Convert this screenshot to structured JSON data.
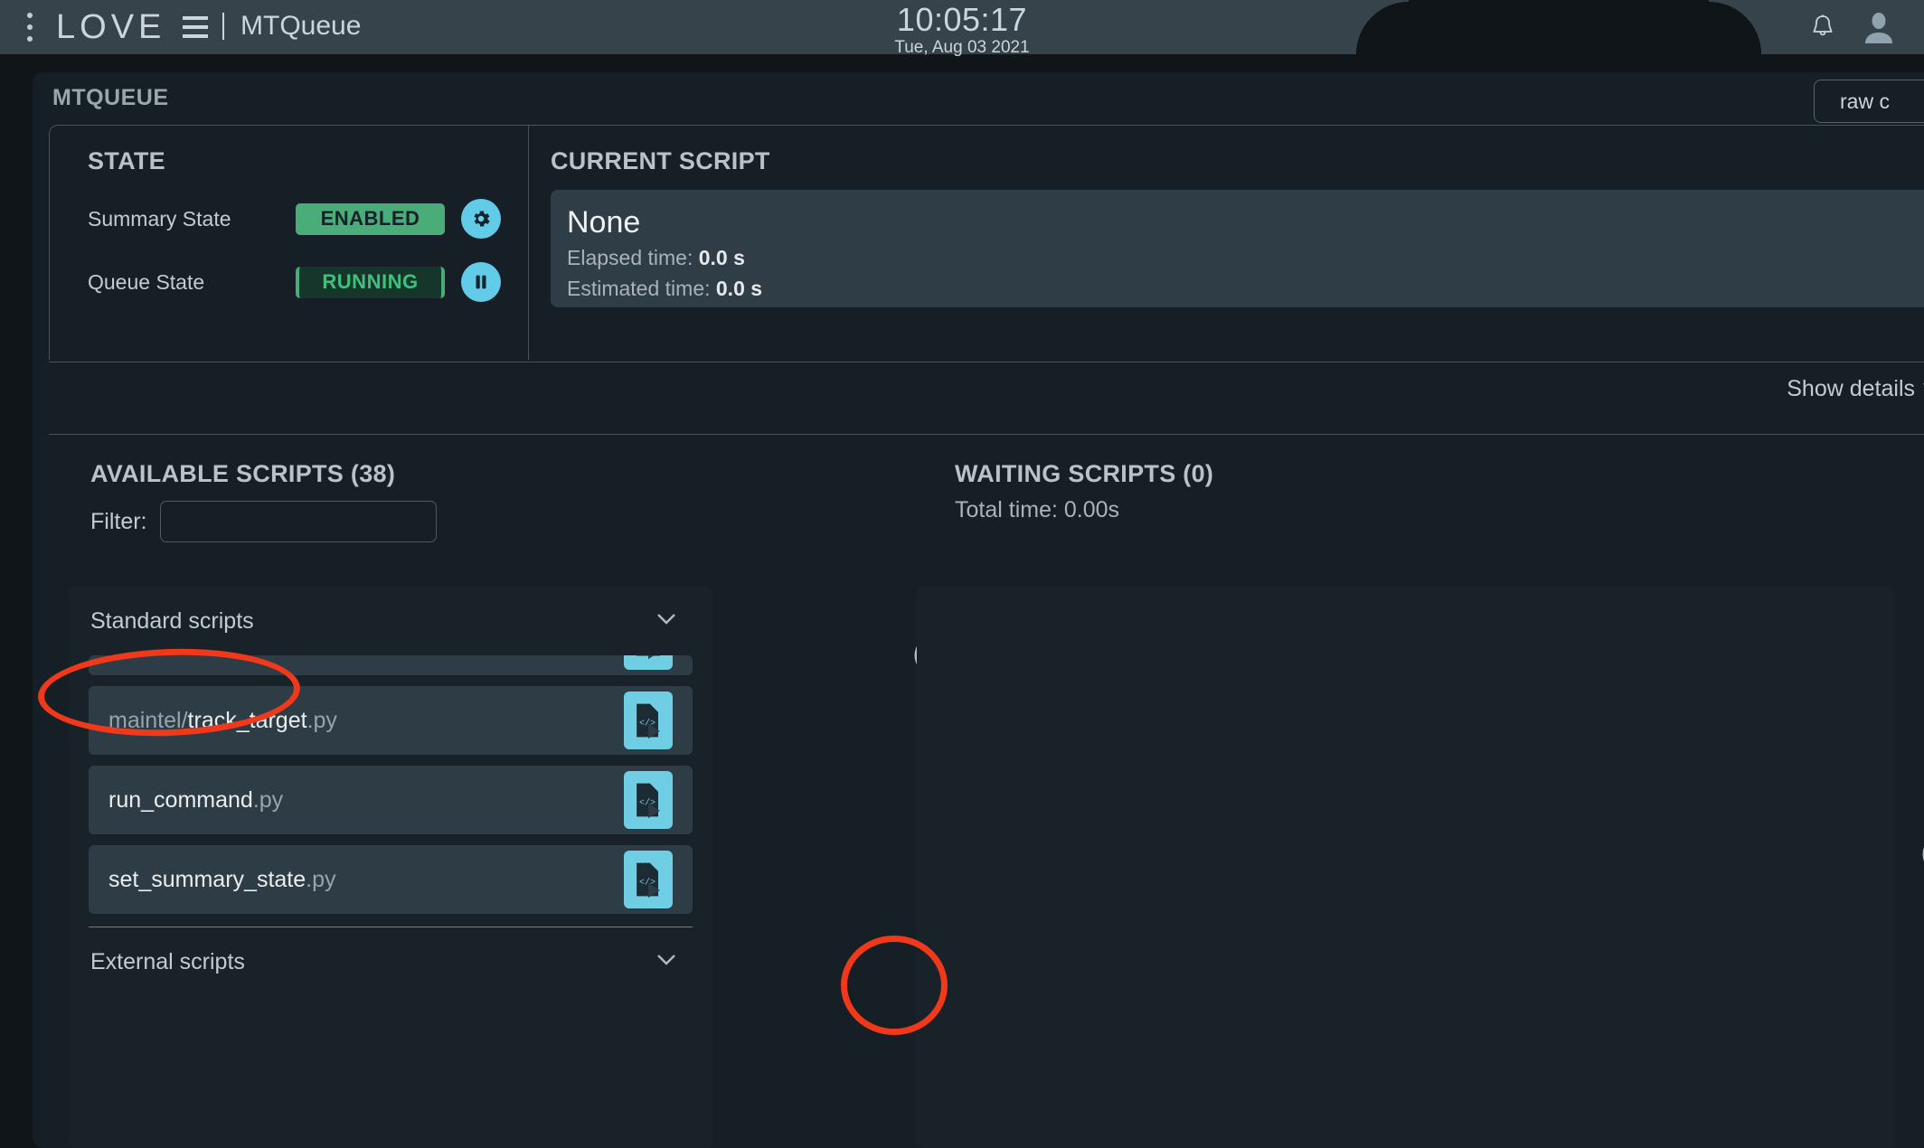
{
  "header": {
    "menu_icon": "kebab-menu-icon",
    "logo_text": "LOVE",
    "separator": "|",
    "app_title": "MTQueue",
    "clock_time": "10:05:17",
    "clock_date": "Tue, Aug 03 2021",
    "notifications_icon": "bell-icon",
    "user_icon": "user-avatar-icon"
  },
  "card": {
    "title": "MTQUEUE",
    "raw_button": "raw c"
  },
  "state": {
    "heading": "STATE",
    "summary_label": "Summary State",
    "summary_value": "ENABLED",
    "summary_action_icon": "gear-icon",
    "queue_label": "Queue State",
    "queue_value": "RUNNING",
    "queue_action_icon": "pause-icon"
  },
  "current_script": {
    "heading": "CURRENT SCRIPT",
    "name": "None",
    "elapsed_label": "Elapsed time:",
    "elapsed_value": "0.0 s",
    "estimated_label": "Estimated time:",
    "estimated_value": "0.0 s"
  },
  "details": {
    "label": "Show details",
    "chevron_icon": "chevron-down-icon"
  },
  "available": {
    "heading": "AVAILABLE SCRIPTS (38)",
    "filter_label": "Filter:",
    "filter_value": "",
    "filter_placeholder": "",
    "collapse_all_icon": "minus-circle-icon",
    "groups": [
      {
        "label": "Standard scripts",
        "chevron_icon": "chevron-down-icon",
        "scripts": [
          {
            "prefix": "",
            "name": "",
            "ext": "",
            "run_icon": "run-script-icon"
          },
          {
            "prefix": "maintel/",
            "name": "track_target",
            "ext": ".py",
            "run_icon": "run-script-icon"
          },
          {
            "prefix": "",
            "name": "run_command",
            "ext": ".py",
            "run_icon": "run-script-icon"
          },
          {
            "prefix": "",
            "name": "set_summary_state",
            "ext": ".py",
            "run_icon": "run-script-icon"
          }
        ]
      },
      {
        "label": "External scripts",
        "chevron_icon": "chevron-down-icon",
        "scripts": []
      }
    ]
  },
  "waiting": {
    "heading": "WAITING SCRIPTS (0)",
    "total_time_label": "Total time: 0.00s",
    "edge_icon": "minus-circle-icon"
  },
  "colors": {
    "accent_cyan": "#6fcde4",
    "state_green": "#4aac78",
    "running_green": "#3fc07e",
    "annotation_red": "#f0391b",
    "bar_bg": "#36434b",
    "page_bg": "#0f1519",
    "card_bg": "#161f26"
  }
}
